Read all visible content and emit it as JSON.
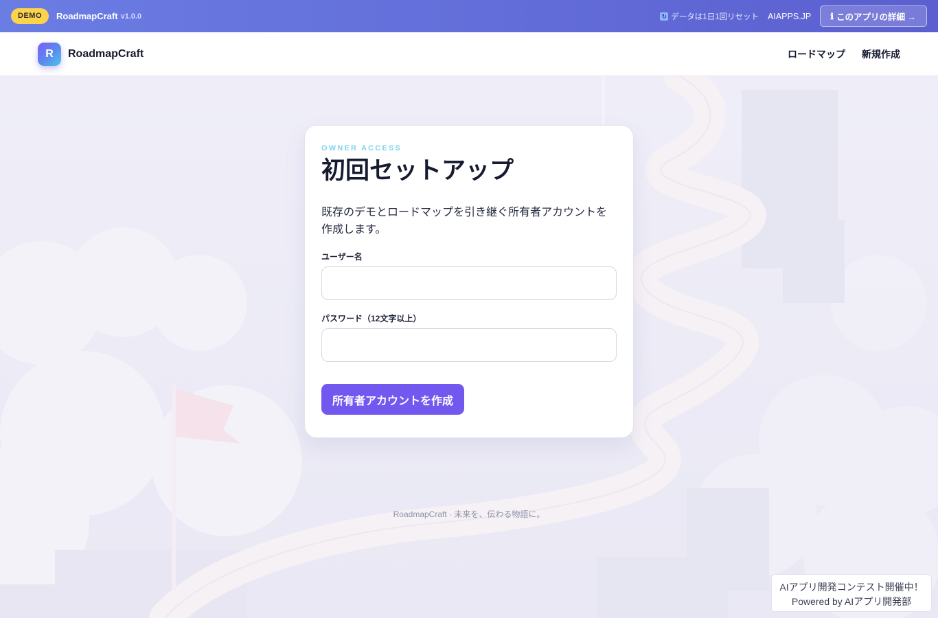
{
  "demo_bar": {
    "badge": "DEMO",
    "app_name": "RoadmapCraft",
    "version": "v1.0.0",
    "reset_icon": "refresh-icon",
    "reset_note": "データは1日1回リセット",
    "site_link": "AIAPPS.JP",
    "details_icon": "ℹ",
    "details_button": "このアプリの詳細 →"
  },
  "header": {
    "logo_letter": "R",
    "brand": "RoadmapCraft",
    "nav": [
      {
        "label": "ロードマップ"
      },
      {
        "label": "新規作成"
      }
    ]
  },
  "setup": {
    "eyebrow": "OWNER ACCESS",
    "title": "初回セットアップ",
    "description": "既存のデモとロードマップを引き継ぐ所有者アカウントを作成します。",
    "username_label": "ユーザー名",
    "username_value": "",
    "password_label": "パスワード（12文字以上）",
    "password_value": "",
    "submit_label": "所有者アカウントを作成"
  },
  "footer": {
    "tagline": "RoadmapCraft · 未来を、伝わる物語に。"
  },
  "contest": {
    "line1": "AIアプリ開発コンテスト開催中！",
    "line2": "Powered by AIアプリ開発部"
  },
  "colors": {
    "accent": "#7358f0",
    "demo_bar": "#6470db",
    "badge": "#fcd34d",
    "eyebrow": "#7fd3ec"
  }
}
